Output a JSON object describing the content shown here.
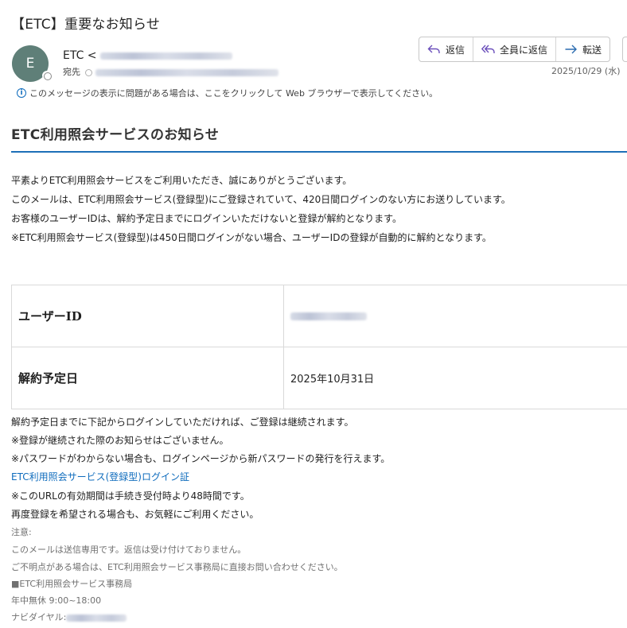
{
  "subject": "【ETC】重要なお知らせ",
  "sender": {
    "avatar_letter": "E",
    "name": "ETC <",
    "to_label": "宛先"
  },
  "actions": {
    "reply": "返信",
    "reply_all": "全員に返信",
    "forward": "転送"
  },
  "date": "2025/10/29 (水)",
  "infobar": "このメッセージの表示に問題がある場合は、ここをクリックして Web ブラウザーで表示してください。",
  "body": {
    "heading": "ETC利用照会サービスのお知らせ",
    "intro": [
      "平素よりETC利用照会サービスをご利用いただき、誠にありがとうございます。",
      "このメールは、ETC利用照会サービス(登録型)にご登録されていて、420日間ログインのない方にお送りしています。",
      "お客様のユーザーIDは、解約予定日までにログインいただけないと登録が解約となります。",
      "※ETC利用照会サービス(登録型)は450日間ログインがない場合、ユーザーIDの登録が自動的に解約となります。"
    ],
    "table": {
      "user_id_label": "ユーザーID",
      "cancel_date_label": "解約予定日",
      "cancel_date_value": "2025年10月31日"
    },
    "after": [
      "解約予定日までに下記からログインしていただければ、ご登録は継続されます。",
      "※登録が継続された際のお知らせはございません。",
      "※パスワードがわからない場合も、ログインページから新パスワードの発行を行えます。"
    ],
    "login_link": "ETC利用照会サービス(登録型)ログイン証",
    "after2": [
      "※このURLの有効期間は手続き受付時より48時間です。",
      "再度登録を希望される場合も、お気軽にご利用ください。"
    ],
    "notes": [
      "注意:",
      "このメールは送信専用です。返信は受け付けておりません。",
      "ご不明点がある場合は、ETC利用照会サービス事務局に直接お問い合わせください。",
      "■ETC利用照会サービス事務局",
      "年中無休 9:00~18:00",
      "ナビダイヤル:"
    ]
  },
  "colors": {
    "accent": "#1d6fb8",
    "link": "#0f6cbd",
    "avatar": "#5f7f78"
  },
  "icons": [
    "reply-icon",
    "reply-all-icon",
    "forward-icon",
    "info-icon"
  ]
}
